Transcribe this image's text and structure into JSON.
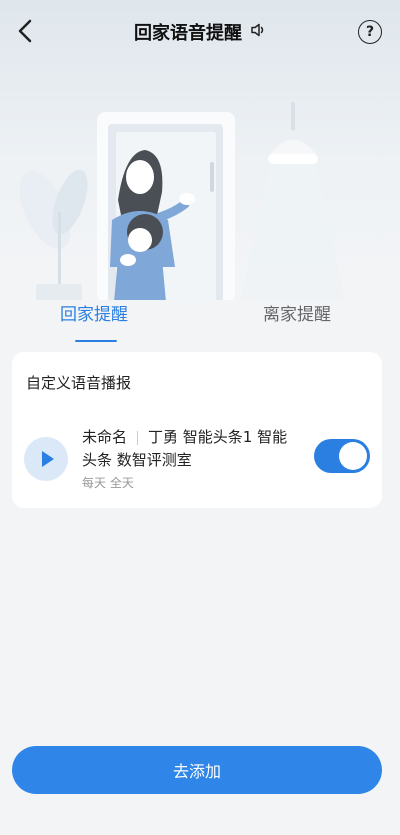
{
  "header": {
    "title": "回家语音提醒",
    "help": "?"
  },
  "tabs": [
    {
      "label": "回家提醒",
      "active": true
    },
    {
      "label": "离家提醒",
      "active": false
    }
  ],
  "card": {
    "title": "自定义语音播报",
    "item": {
      "name": "未命名",
      "content": "丁勇 智能头条1 智能头条 数智评测室",
      "schedule": "每天 全天",
      "enabled": true
    }
  },
  "actions": {
    "add_label": "去添加"
  },
  "colors": {
    "accent": "#2a7fe0",
    "toggle_on": "#2a7fe0",
    "button": "#2f86e8"
  }
}
